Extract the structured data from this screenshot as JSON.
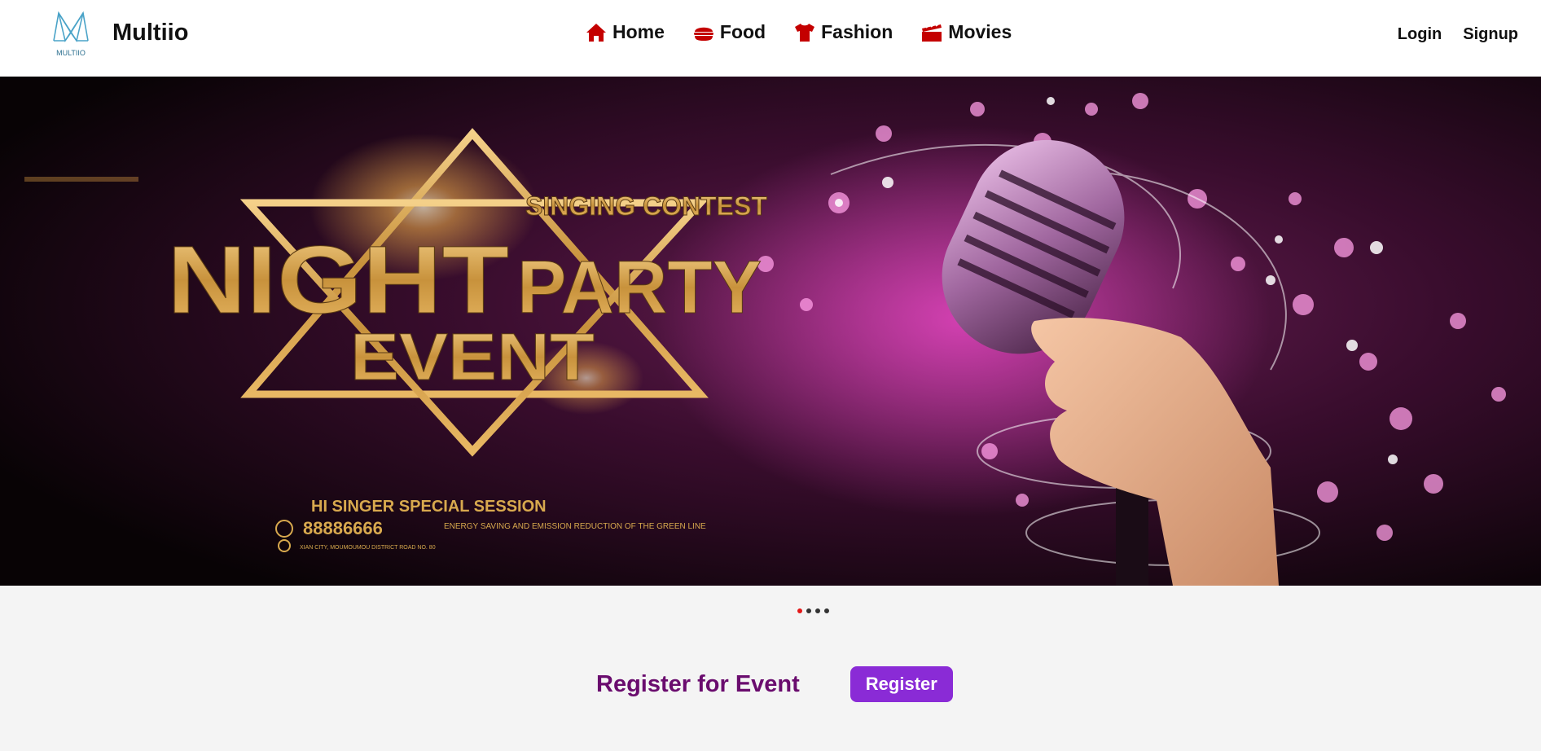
{
  "brand": {
    "name": "Multiio",
    "logo_text": "MULTIIO"
  },
  "nav": {
    "items": [
      {
        "label": "Home",
        "icon": "home-icon"
      },
      {
        "label": "Food",
        "icon": "food-icon"
      },
      {
        "label": "Fashion",
        "icon": "shirt-icon"
      },
      {
        "label": "Movies",
        "icon": "clapperboard-icon"
      }
    ],
    "icon_color": "#c40000"
  },
  "auth": {
    "login_label": "Login",
    "signup_label": "Signup"
  },
  "banner": {
    "top_text": "SINGING CONTEST",
    "headline_1": "NIGHT",
    "headline_2": "PARTY",
    "headline_3": "EVENT",
    "session_text": "HI SINGER SPECIAL SESSION",
    "phone": "88886666",
    "address": "XIAN CITY, MOUMOUMOU DISTRICT ROAD NO. 80",
    "tagline": "ENERGY SAVING AND EMISSION REDUCTION OF THE GREEN LINE"
  },
  "carousel": {
    "slide_count": 4,
    "active_index": 0
  },
  "register": {
    "title": "Register for Event",
    "button_label": "Register"
  },
  "colors": {
    "accent": "#8a2bd6",
    "title": "#6a0c6e",
    "active_dot": "#e41818",
    "gold": "#d8a94e"
  }
}
